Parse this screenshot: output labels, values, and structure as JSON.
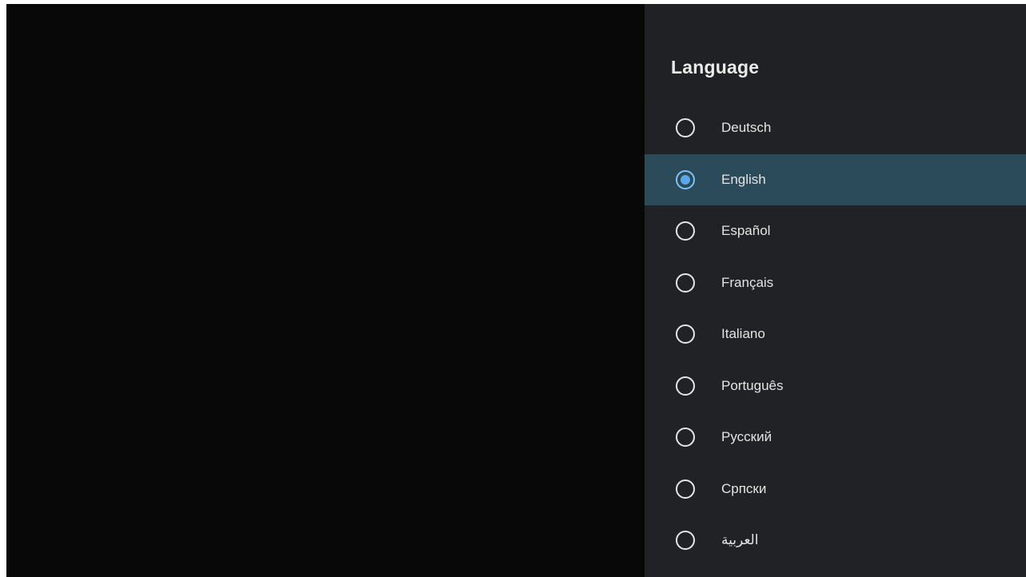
{
  "panel": {
    "title": "Language",
    "selected_index": 1,
    "items": [
      {
        "label": "Deutsch",
        "selected": false
      },
      {
        "label": "English",
        "selected": true
      },
      {
        "label": "Español",
        "selected": false
      },
      {
        "label": "Français",
        "selected": false
      },
      {
        "label": "Italiano",
        "selected": false
      },
      {
        "label": "Português",
        "selected": false
      },
      {
        "label": "Русский",
        "selected": false
      },
      {
        "label": "Српски",
        "selected": false
      },
      {
        "label": "العربية",
        "selected": false
      }
    ]
  },
  "colors": {
    "background": "#080808",
    "panel": "#212225",
    "selected_row": "#2b4a5a",
    "radio_selected": "#5aa8ea",
    "text": "#e4e4e4"
  },
  "icons": {
    "radio_unchecked": "radio-unchecked-icon",
    "radio_checked": "radio-checked-icon"
  }
}
